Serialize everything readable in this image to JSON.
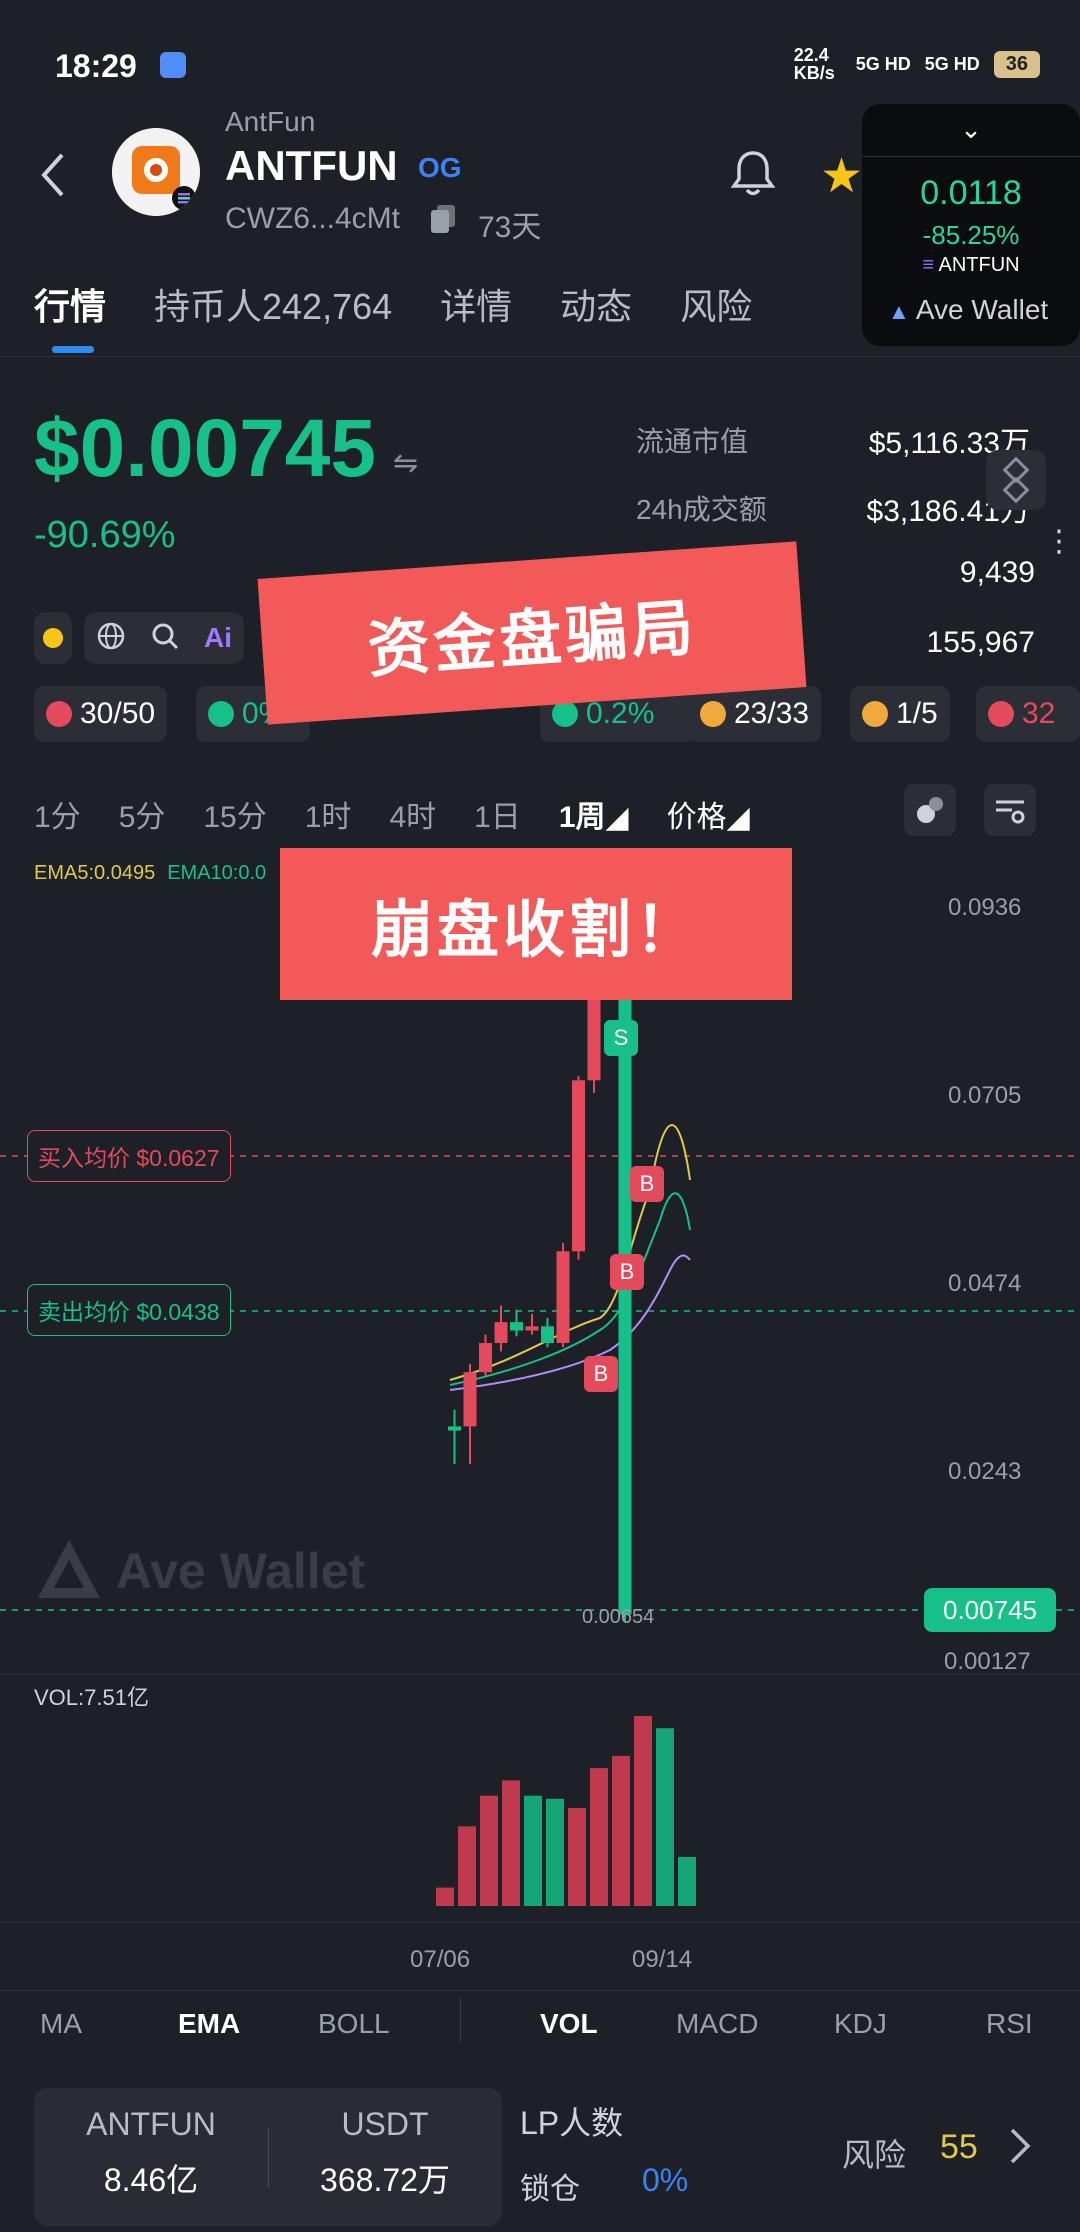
{
  "status_bar": {
    "time": "18:29",
    "net_speed": "22.4 KB/s",
    "signal1": "5G HD",
    "signal2": "5G HD",
    "battery": "36"
  },
  "header": {
    "subtitle": "AntFun",
    "name": "ANTFUN",
    "badge": "OG",
    "address": "CWZ6...4cMt",
    "age": "73天"
  },
  "mini_widget": {
    "price": "0.0118",
    "change": "-85.25%",
    "token": "ANTFUN",
    "brand": "Ave Wallet"
  },
  "tabs": [
    {
      "label": "行情",
      "active": true
    },
    {
      "label": "持币人242,764",
      "active": false
    },
    {
      "label": "详情",
      "active": false
    },
    {
      "label": "动态",
      "active": false
    },
    {
      "label": "风险",
      "active": false
    }
  ],
  "price": {
    "value": "$0.00745",
    "change": "-90.69%"
  },
  "stats": [
    {
      "label": "流通市值",
      "value": "$5,116.33万"
    },
    {
      "label": "24h成交额",
      "value": "$3,186.41万"
    },
    {
      "label": "",
      "value": "9,439"
    },
    {
      "label": "",
      "value": "155,967"
    }
  ],
  "badges": [
    {
      "icon": "user-icon",
      "text": "30/50",
      "color": "#e34b5c"
    },
    {
      "icon": "crown-icon",
      "text": "0%",
      "color": "#17c088"
    },
    {
      "icon": "percent-icon",
      "text": "0.2%",
      "color": "#17c088"
    },
    {
      "icon": "moneybag-icon",
      "text": "23/33",
      "color": "#f0a93b"
    },
    {
      "icon": "trophy-icon",
      "text": "1/5",
      "color": "#f0a93b"
    },
    {
      "icon": "rocket-icon",
      "text": "32",
      "color": "#e34b5c"
    }
  ],
  "overlay": {
    "banner1": "资金盘骗局",
    "banner2": "崩盘收割！"
  },
  "timeframes": [
    {
      "label": "1分",
      "active": false
    },
    {
      "label": "5分",
      "active": false
    },
    {
      "label": "15分",
      "active": false
    },
    {
      "label": "1时",
      "active": false
    },
    {
      "label": "4时",
      "active": false
    },
    {
      "label": "1日",
      "active": false
    },
    {
      "label": "1周",
      "active": true
    },
    {
      "label": "价格",
      "active": false
    }
  ],
  "chart": {
    "ema5": "EMA5:0.0495",
    "ema10": "EMA10:0.0",
    "y_ticks": [
      "0.0936",
      "0.0705",
      "0.0474",
      "0.0243",
      "0.00127"
    ],
    "buy_avg": "买入均价 $0.0627",
    "sell_avg": "卖出均价 $0.0438",
    "current_price_tag": "0.00745",
    "low_label": "0.00654",
    "watermark": "Ave Wallet",
    "x_labels": [
      "07/06",
      "09/14"
    ],
    "markers": [
      "S",
      "B",
      "B",
      "B"
    ]
  },
  "chart_data": {
    "type": "candlestick",
    "ylim": [
      0.00127,
      0.0936
    ],
    "candles": [
      {
        "o": 0.0295,
        "h": 0.032,
        "l": 0.0255,
        "c": 0.03,
        "dir": "down"
      },
      {
        "o": 0.03,
        "h": 0.0375,
        "l": 0.0255,
        "c": 0.0365,
        "dir": "up"
      },
      {
        "o": 0.0365,
        "h": 0.041,
        "l": 0.036,
        "c": 0.04,
        "dir": "up"
      },
      {
        "o": 0.04,
        "h": 0.0445,
        "l": 0.039,
        "c": 0.0425,
        "dir": "up"
      },
      {
        "o": 0.0425,
        "h": 0.044,
        "l": 0.0408,
        "c": 0.0415,
        "dir": "down"
      },
      {
        "o": 0.0415,
        "h": 0.0435,
        "l": 0.041,
        "c": 0.042,
        "dir": "up"
      },
      {
        "o": 0.042,
        "h": 0.043,
        "l": 0.0395,
        "c": 0.04,
        "dir": "down"
      },
      {
        "o": 0.04,
        "h": 0.052,
        "l": 0.0395,
        "c": 0.051,
        "dir": "up"
      },
      {
        "o": 0.051,
        "h": 0.072,
        "l": 0.05,
        "c": 0.0715,
        "dir": "up"
      },
      {
        "o": 0.0715,
        "h": 0.09,
        "l": 0.07,
        "c": 0.087,
        "dir": "up"
      },
      {
        "o": 0.087,
        "h": 0.089,
        "l": 0.082,
        "c": 0.0865,
        "dir": "down"
      },
      {
        "o": 0.0865,
        "h": 0.0875,
        "l": 0.00654,
        "c": 0.00745,
        "dir": "down"
      }
    ],
    "volume": [
      {
        "v": 0.6,
        "dir": "up"
      },
      {
        "v": 2.6,
        "dir": "up"
      },
      {
        "v": 3.6,
        "dir": "up"
      },
      {
        "v": 4.1,
        "dir": "up"
      },
      {
        "v": 3.6,
        "dir": "down"
      },
      {
        "v": 3.5,
        "dir": "down"
      },
      {
        "v": 3.2,
        "dir": "up"
      },
      {
        "v": 4.5,
        "dir": "up"
      },
      {
        "v": 4.9,
        "dir": "up"
      },
      {
        "v": 6.2,
        "dir": "up"
      },
      {
        "v": 5.8,
        "dir": "down"
      },
      {
        "v": 1.6,
        "dir": "down"
      }
    ],
    "volume_label": "VOL:7.51亿"
  },
  "indicators": [
    {
      "label": "MA",
      "active": false
    },
    {
      "label": "EMA",
      "active": true
    },
    {
      "label": "BOLL",
      "active": false
    },
    {
      "label": "VOL",
      "active": true
    },
    {
      "label": "MACD",
      "active": false
    },
    {
      "label": "KDJ",
      "active": false
    },
    {
      "label": "RSI",
      "active": false
    }
  ],
  "pool": {
    "token_a": "ANTFUN",
    "amount_a": "8.46亿",
    "token_b": "USDT",
    "amount_b": "368.72万"
  },
  "lp": {
    "label": "LP人数",
    "lock_label": "锁仓",
    "lock_value": "0%"
  },
  "risk": {
    "label": "风险",
    "score": "55"
  },
  "colors": {
    "up": "#e34b5c",
    "down": "#17c088",
    "accent": "#2d8cf0",
    "banner": "#f25a5a"
  }
}
